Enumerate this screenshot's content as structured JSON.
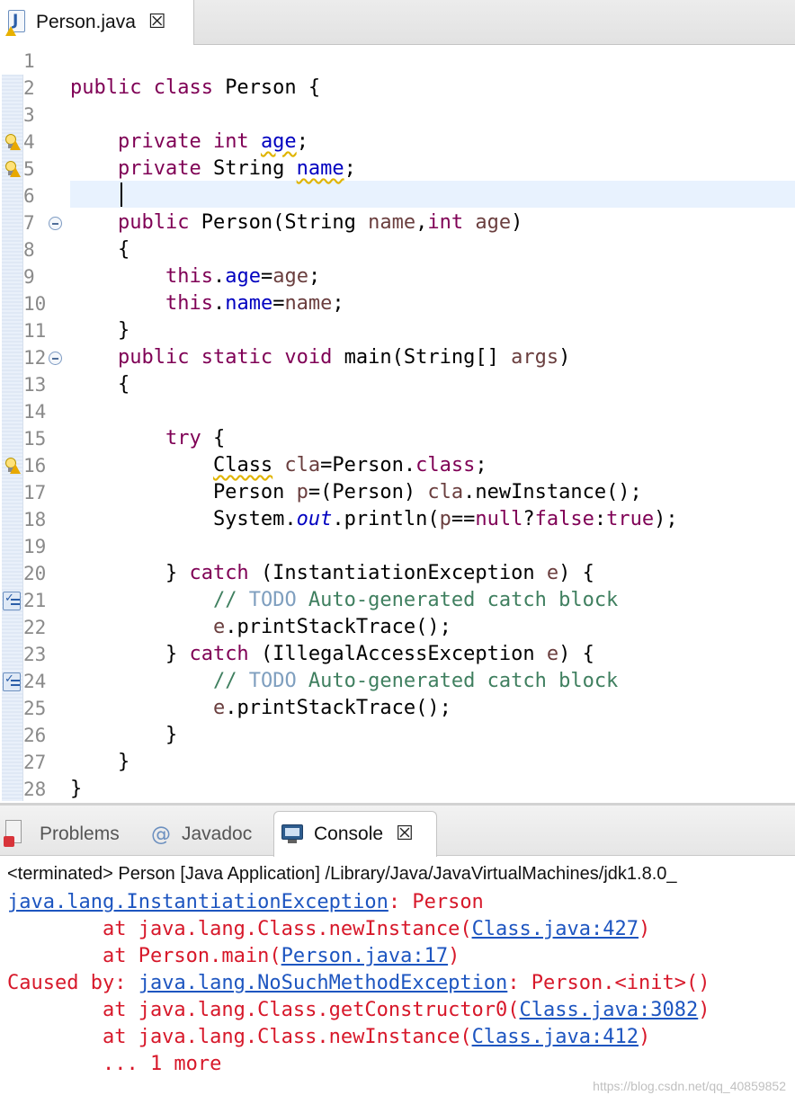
{
  "editor_tab": {
    "title": "Person.java",
    "close_glyph": "☒"
  },
  "editor": {
    "rows": [
      {
        "n": "1",
        "icon": "",
        "fold": false,
        "code": []
      },
      {
        "n": "2",
        "icon": "",
        "fold": false,
        "code": [
          [
            "kw",
            "public class "
          ],
          [
            "",
            "Person {"
          ]
        ]
      },
      {
        "n": "3",
        "icon": "",
        "fold": false,
        "code": []
      },
      {
        "n": "4",
        "icon": "bulb",
        "fold": false,
        "code": [
          [
            "",
            "    "
          ],
          [
            "kw",
            "private int "
          ],
          [
            "fld wavy",
            "age"
          ],
          [
            "",
            ";"
          ]
        ]
      },
      {
        "n": "5",
        "icon": "bulb",
        "fold": false,
        "code": [
          [
            "",
            "    "
          ],
          [
            "kw",
            "private "
          ],
          [
            "",
            "String "
          ],
          [
            "fld wavy",
            "name"
          ],
          [
            "",
            ";"
          ]
        ]
      },
      {
        "n": "6",
        "icon": "",
        "fold": false,
        "code": []
      },
      {
        "n": "7",
        "icon": "",
        "fold": true,
        "code": [
          [
            "",
            "    "
          ],
          [
            "kw",
            "public "
          ],
          [
            "",
            "Person(String "
          ],
          [
            "loc",
            "name"
          ],
          [
            "",
            ","
          ],
          [
            "kw",
            "int "
          ],
          [
            "loc",
            "age"
          ],
          [
            "",
            ")"
          ]
        ]
      },
      {
        "n": "8",
        "icon": "",
        "fold": false,
        "code": [
          [
            "",
            "    {"
          ]
        ]
      },
      {
        "n": "9",
        "icon": "",
        "fold": false,
        "code": [
          [
            "",
            "        "
          ],
          [
            "kw",
            "this"
          ],
          [
            "",
            "."
          ],
          [
            "fld",
            "age"
          ],
          [
            "",
            "="
          ],
          [
            "loc",
            "age"
          ],
          [
            "",
            ";"
          ]
        ]
      },
      {
        "n": "10",
        "icon": "",
        "fold": false,
        "code": [
          [
            "",
            "        "
          ],
          [
            "kw",
            "this"
          ],
          [
            "",
            "."
          ],
          [
            "fld",
            "name"
          ],
          [
            "",
            "="
          ],
          [
            "loc",
            "name"
          ],
          [
            "",
            ";"
          ]
        ]
      },
      {
        "n": "11",
        "icon": "",
        "fold": false,
        "code": [
          [
            "",
            "    }"
          ]
        ]
      },
      {
        "n": "12",
        "icon": "",
        "fold": true,
        "code": [
          [
            "",
            "    "
          ],
          [
            "kw",
            "public static void "
          ],
          [
            "",
            "main(String[] "
          ],
          [
            "loc",
            "args"
          ],
          [
            "",
            ")"
          ]
        ]
      },
      {
        "n": "13",
        "icon": "",
        "fold": false,
        "code": [
          [
            "",
            "    {"
          ]
        ]
      },
      {
        "n": "14",
        "icon": "",
        "fold": false,
        "code": []
      },
      {
        "n": "15",
        "icon": "",
        "fold": false,
        "code": [
          [
            "",
            "        "
          ],
          [
            "kw",
            "try "
          ],
          [
            "",
            "{"
          ]
        ]
      },
      {
        "n": "16",
        "icon": "bulb",
        "fold": false,
        "code": [
          [
            "",
            "            "
          ],
          [
            "wavy",
            "Class"
          ],
          [
            "loc",
            " cla"
          ],
          [
            "",
            "=Person."
          ],
          [
            "kw",
            "class"
          ],
          [
            "",
            ";"
          ]
        ]
      },
      {
        "n": "17",
        "icon": "",
        "fold": false,
        "code": [
          [
            "",
            "            Person "
          ],
          [
            "loc",
            "p"
          ],
          [
            "",
            "=(Person) "
          ],
          [
            "loc",
            "cla"
          ],
          [
            "",
            ".newInstance();"
          ]
        ]
      },
      {
        "n": "18",
        "icon": "",
        "fold": false,
        "code": [
          [
            "",
            "            System."
          ],
          [
            "stat",
            "out"
          ],
          [
            "",
            ".println("
          ],
          [
            "loc",
            "p"
          ],
          [
            "",
            "=="
          ],
          [
            "kw",
            "null"
          ],
          [
            "",
            "?"
          ],
          [
            "kw",
            "false"
          ],
          [
            "",
            ":"
          ],
          [
            "kw",
            "true"
          ],
          [
            "",
            ");"
          ]
        ]
      },
      {
        "n": "19",
        "icon": "",
        "fold": false,
        "code": []
      },
      {
        "n": "20",
        "icon": "",
        "fold": false,
        "code": [
          [
            "",
            "        } "
          ],
          [
            "kw",
            "catch "
          ],
          [
            "",
            "(InstantiationException "
          ],
          [
            "loc",
            "e"
          ],
          [
            "",
            ") {"
          ]
        ]
      },
      {
        "n": "21",
        "icon": "task",
        "fold": false,
        "code": [
          [
            "",
            "            "
          ],
          [
            "cmt",
            "// "
          ],
          [
            "todo",
            "TODO"
          ],
          [
            "cmt",
            " Auto-generated catch block"
          ]
        ]
      },
      {
        "n": "22",
        "icon": "",
        "fold": false,
        "code": [
          [
            "",
            "            "
          ],
          [
            "loc",
            "e"
          ],
          [
            "",
            ".printStackTrace();"
          ]
        ]
      },
      {
        "n": "23",
        "icon": "",
        "fold": false,
        "code": [
          [
            "",
            "        } "
          ],
          [
            "kw",
            "catch "
          ],
          [
            "",
            "(IllegalAccessException "
          ],
          [
            "loc",
            "e"
          ],
          [
            "",
            ") {"
          ]
        ]
      },
      {
        "n": "24",
        "icon": "task",
        "fold": false,
        "code": [
          [
            "",
            "            "
          ],
          [
            "cmt",
            "// "
          ],
          [
            "todo",
            "TODO"
          ],
          [
            "cmt",
            " Auto-generated catch block"
          ]
        ]
      },
      {
        "n": "25",
        "icon": "",
        "fold": false,
        "code": [
          [
            "",
            "            "
          ],
          [
            "loc",
            "e"
          ],
          [
            "",
            ".printStackTrace();"
          ]
        ]
      },
      {
        "n": "26",
        "icon": "",
        "fold": false,
        "code": [
          [
            "",
            "        }"
          ]
        ]
      },
      {
        "n": "27",
        "icon": "",
        "fold": false,
        "code": [
          [
            "",
            "    }"
          ]
        ]
      },
      {
        "n": "28",
        "icon": "",
        "fold": false,
        "code": [
          [
            "",
            "}"
          ]
        ]
      }
    ]
  },
  "panel": {
    "tabs": {
      "problems": "Problems",
      "javadoc": "Javadoc",
      "console": "Console",
      "javadoc_glyph": "@",
      "close_glyph": "☒"
    }
  },
  "console": {
    "header": "<terminated> Person [Java Application] /Library/Java/JavaVirtualMachines/jdk1.8.0_",
    "lines": [
      [
        [
          "lnk",
          "java.lang.InstantiationException"
        ],
        [
          "",
          ": Person"
        ]
      ],
      [
        [
          "",
          "        at java.lang.Class.newInstance("
        ],
        [
          "lnk",
          "Class.java:427"
        ],
        [
          "",
          ")"
        ]
      ],
      [
        [
          "",
          "        at Person.main("
        ],
        [
          "lnk",
          "Person.java:17"
        ],
        [
          "",
          ")"
        ]
      ],
      [
        [
          "",
          "Caused by: "
        ],
        [
          "lnk",
          "java.lang.NoSuchMethodException"
        ],
        [
          "",
          ": Person.<init>()"
        ]
      ],
      [
        [
          "",
          "        at java.lang.Class.getConstructor0("
        ],
        [
          "lnk",
          "Class.java:3082"
        ],
        [
          "",
          ")"
        ]
      ],
      [
        [
          "",
          "        at java.lang.Class.newInstance("
        ],
        [
          "lnk",
          "Class.java:412"
        ],
        [
          "",
          ")"
        ]
      ],
      [
        [
          "",
          "        ... 1 more"
        ]
      ]
    ]
  },
  "watermark": "https://blog.csdn.net/qq_40859852"
}
